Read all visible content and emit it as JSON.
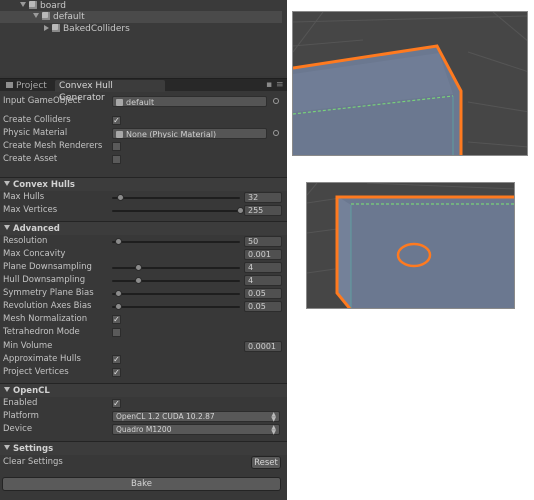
{
  "hierarchy": {
    "items": [
      {
        "label": "board"
      },
      {
        "label": "default"
      },
      {
        "label": "BakedColliders"
      }
    ]
  },
  "tabs": [
    {
      "label": "Project"
    },
    {
      "label": "Convex Hull Generator"
    }
  ],
  "general": {
    "input_gameobject_label": "Input GameObject",
    "input_gameobject_value": "default",
    "create_colliders_label": "Create Colliders",
    "physic_material_label": "Physic Material",
    "physic_material_value": "None (Physic Material)",
    "create_mesh_renderers_label": "Create Mesh Renderers",
    "create_asset_label": "Create Asset",
    "check_mark": "✓"
  },
  "convex_hulls": {
    "title": "Convex Hulls",
    "max_hulls_label": "Max Hulls",
    "max_hulls_value": "32",
    "max_hulls_fraction": 0.06,
    "max_vertices_label": "Max Vertices",
    "max_vertices_value": "255",
    "max_vertices_fraction": 1.0
  },
  "advanced": {
    "title": "Advanced",
    "resolution_label": "Resolution",
    "resolution_value": "50",
    "resolution_fraction": 0.05,
    "max_concavity_label": "Max Concavity",
    "max_concavity_value": "0.001",
    "plane_downsampling_label": "Plane Downsampling",
    "plane_downsampling_value": "4",
    "plane_downsampling_fraction": 0.2,
    "hull_downsampling_label": "Hull Downsampling",
    "hull_downsampling_value": "4",
    "hull_downsampling_fraction": 0.2,
    "symmetry_plane_bias_label": "Symmetry Plane Bias",
    "symmetry_plane_bias_value": "0.05",
    "symmetry_plane_bias_fraction": 0.05,
    "revolution_axes_bias_label": "Revolution Axes Bias",
    "revolution_axes_bias_value": "0.05",
    "revolution_axes_bias_fraction": 0.05,
    "mesh_normalization_label": "Mesh Normalization",
    "tetrahedron_mode_label": "Tetrahedron Mode",
    "min_volume_label": "Min Volume",
    "min_volume_value": "0.0001",
    "approximate_hulls_label": "Approximate Hulls",
    "project_vertices_label": "Project Vertices"
  },
  "opencl": {
    "title": "OpenCL",
    "enabled_label": "Enabled",
    "platform_label": "Platform",
    "platform_value": "OpenCL 1.2 CUDA 10.2.87",
    "device_label": "Device",
    "device_value": "Quadro M1200"
  },
  "settings": {
    "title": "Settings",
    "clear_settings_label": "Clear Settings",
    "reset_label": "Reset"
  },
  "bake_label": "Bake",
  "colors": {
    "editor_bg": "#383838",
    "outline": "#ff7a1f",
    "mesh_fill": "#6b7890",
    "accent_line": "#78d27a"
  }
}
